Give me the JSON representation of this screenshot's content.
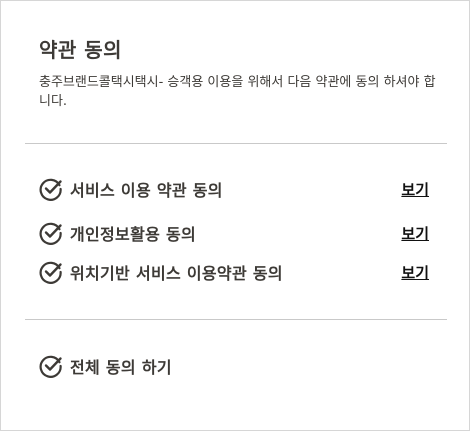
{
  "dialog": {
    "title": "약관 동의",
    "description": "충주브랜드콜택시택시- 승객용 이용을 위해서 다음 약관에 동의 하셔야 합니다."
  },
  "terms": [
    {
      "label": "서비스 이용 약관 동의",
      "link": "보기",
      "checked": true
    },
    {
      "label": "개인정보활용 동의",
      "link": "보기",
      "checked": true
    },
    {
      "label": "위치기반 서비스 이용약관 동의",
      "link": "보기",
      "checked": true
    }
  ],
  "agree_all": {
    "label": "전체 동의 하기",
    "checked": true
  },
  "colors": {
    "text": "#3d3a36",
    "link": "#111111",
    "divider": "#c9c9c9"
  },
  "icons": {
    "check": "check-circle-icon"
  }
}
